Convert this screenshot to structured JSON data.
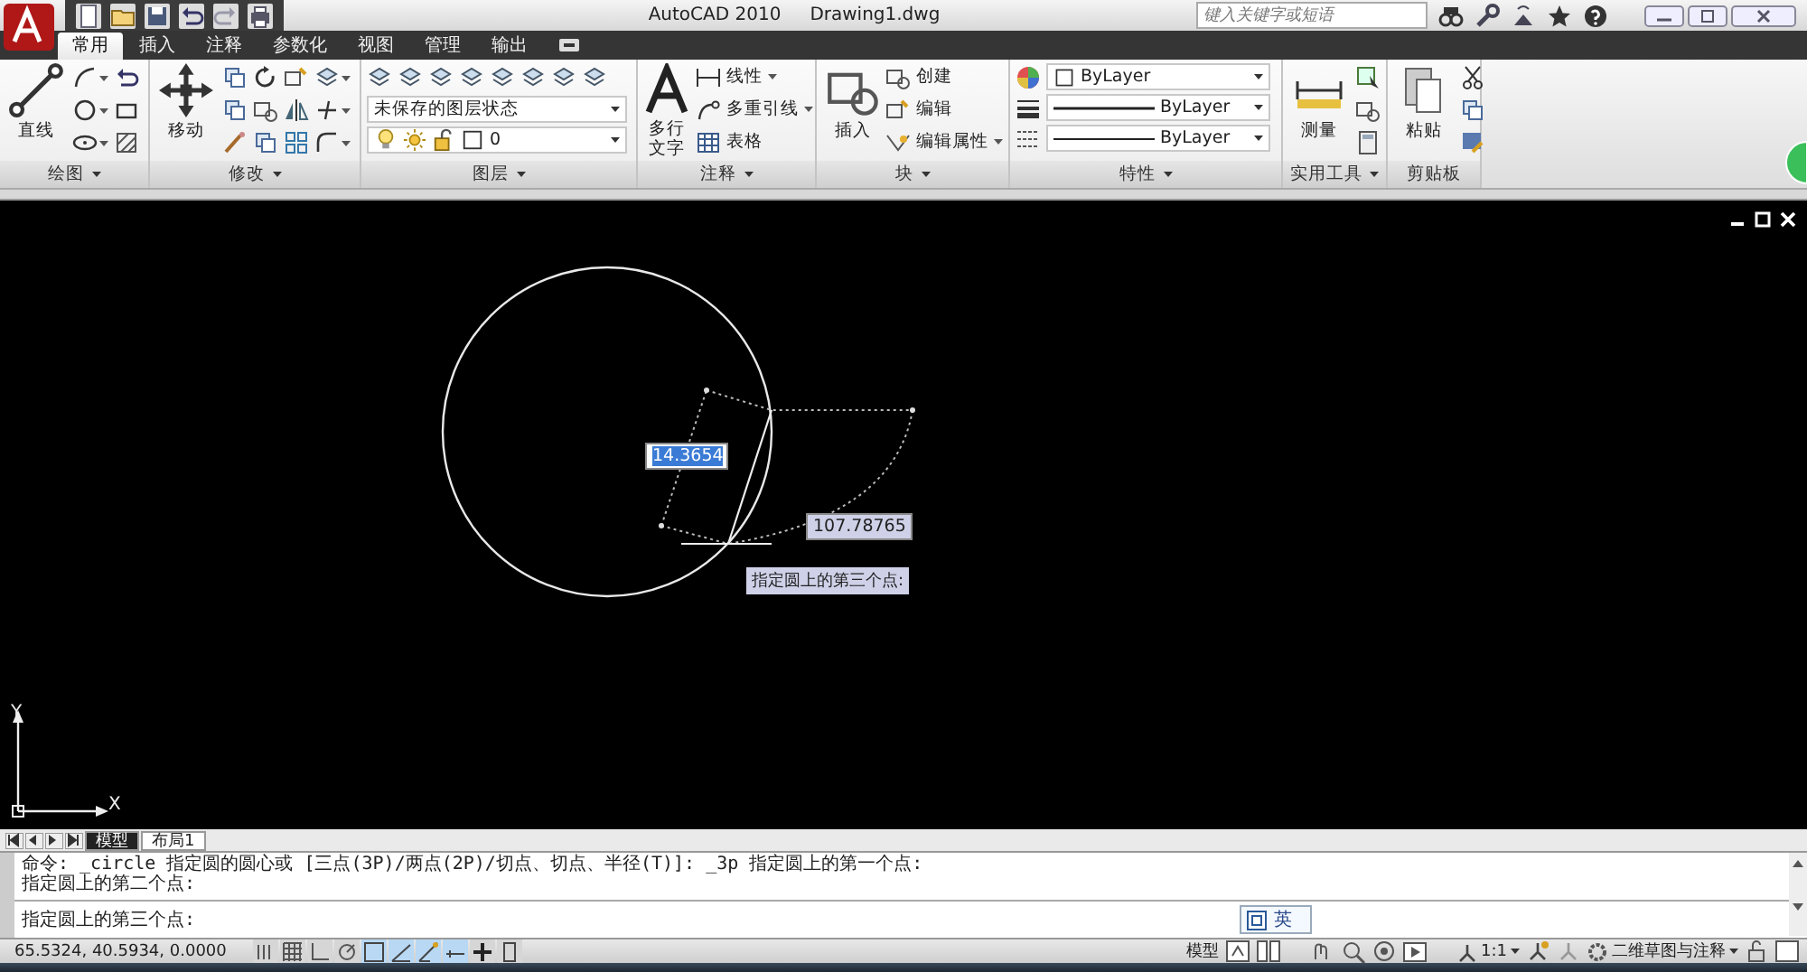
{
  "title_bar": {
    "app": "AutoCAD 2010",
    "file": "Drawing1.dwg",
    "search": {
      "placeholder": "键入关键字或短语"
    }
  },
  "ribbon_tabs": [
    {
      "label": "常用",
      "selected": true
    },
    {
      "label": "插入",
      "selected": false
    },
    {
      "label": "注释",
      "selected": false
    },
    {
      "label": "参数化",
      "selected": false
    },
    {
      "label": "视图",
      "selected": false
    },
    {
      "label": "管理",
      "selected": false
    },
    {
      "label": "输出",
      "selected": false
    }
  ],
  "ribbon_panels": [
    {
      "kind": "draw",
      "title": "绘图",
      "big": "直线"
    },
    {
      "kind": "modify",
      "title": "修改",
      "big": "移动"
    },
    {
      "kind": "layer",
      "title": "图层",
      "state": "未保存的图层状态",
      "layer": "0"
    },
    {
      "kind": "annotate",
      "title": "注释",
      "big": "多行文字",
      "tools": [
        "线性",
        "多重引线",
        "表格"
      ]
    },
    {
      "kind": "block",
      "title": "块",
      "big": "插入",
      "tools": [
        "创建",
        "编辑",
        "编辑属性"
      ]
    },
    {
      "kind": "properties",
      "title": "特性",
      "values": [
        "ByLayer",
        "ByLayer",
        "ByLayer"
      ]
    },
    {
      "kind": "utilities",
      "title": "实用工具",
      "big": "测量"
    },
    {
      "kind": "clipboard",
      "title": "剪贴板",
      "big": "粘贴"
    }
  ],
  "canvas": {
    "radius_input": "14.3654",
    "angle_input": "107.78765",
    "tooltip": "指定圆上的第三个点:",
    "ucs": {
      "x": "X",
      "y": "Y"
    }
  },
  "layout_tabs": [
    {
      "label": "模型",
      "selected": true
    },
    {
      "label": "布局1",
      "selected": false
    }
  ],
  "command_lines": [
    "命令:  _circle 指定圆的圆心或 [三点(3P)/两点(2P)/切点、切点、半径(T)]: _3p 指定圆上的第一个点:",
    "指定圆上的第二个点:"
  ],
  "command_prompt": "指定圆上的第三个点:",
  "ime": "英",
  "status_bar": {
    "coords": "65.5324, 40.5934, 0.0000",
    "toggles": [
      {
        "on": false
      },
      {
        "on": false
      },
      {
        "on": false
      },
      {
        "on": false
      },
      {
        "on": true
      },
      {
        "on": true
      },
      {
        "on": true
      },
      {
        "on": true
      },
      {
        "on": false
      },
      {
        "on": false
      }
    ],
    "space": "模型",
    "scale": "1:1",
    "workspace": "二维草图与注释"
  }
}
